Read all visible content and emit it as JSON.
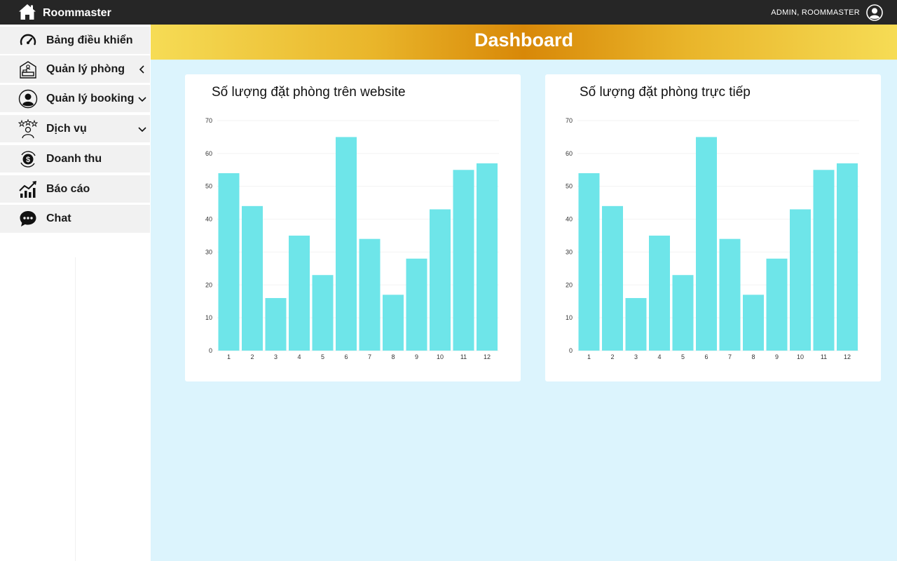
{
  "app": {
    "name": "Roommaster"
  },
  "user": {
    "label": "ADMIN, ROOMMASTER"
  },
  "sidebar": {
    "items": [
      {
        "label": "Bảng điều khiển",
        "icon": "speedometer-icon",
        "arrow": ""
      },
      {
        "label": "Quản lý phòng",
        "icon": "room-icon",
        "arrow": "chevron-left"
      },
      {
        "label": "Quản lý booking",
        "icon": "user-circle-icon",
        "arrow": "chevron-down"
      },
      {
        "label": "Dịch vụ",
        "icon": "service-rating-icon",
        "arrow": "chevron-down"
      },
      {
        "label": "Doanh thu",
        "icon": "money-icon",
        "arrow": ""
      },
      {
        "label": "Báo cáo",
        "icon": "growth-chart-icon",
        "arrow": ""
      },
      {
        "label": "Chat",
        "icon": "chat-bubble-icon",
        "arrow": ""
      }
    ]
  },
  "page": {
    "title": "Dashboard"
  },
  "colors": {
    "bar": "#6ee5e9",
    "topbar": "#262626",
    "main_bg": "#dcf4fd"
  },
  "chart_data": [
    {
      "type": "bar",
      "title": "Số lượng đặt phòng trên website",
      "categories": [
        "1",
        "2",
        "3",
        "4",
        "5",
        "6",
        "7",
        "8",
        "9",
        "10",
        "11",
        "12"
      ],
      "values": [
        54,
        44,
        16,
        35,
        23,
        65,
        34,
        17,
        28,
        43,
        55,
        57
      ],
      "ylim": [
        0,
        70
      ],
      "yticks": [
        0,
        10,
        20,
        30,
        40,
        50,
        60,
        70
      ],
      "xlabel": "",
      "ylabel": "",
      "grid": true
    },
    {
      "type": "bar",
      "title": "Số lượng đặt phòng trực tiếp",
      "categories": [
        "1",
        "2",
        "3",
        "4",
        "5",
        "6",
        "7",
        "8",
        "9",
        "10",
        "11",
        "12"
      ],
      "values": [
        54,
        44,
        16,
        35,
        23,
        65,
        34,
        17,
        28,
        43,
        55,
        57
      ],
      "ylim": [
        0,
        70
      ],
      "yticks": [
        0,
        10,
        20,
        30,
        40,
        50,
        60,
        70
      ],
      "xlabel": "",
      "ylabel": "",
      "grid": true
    }
  ]
}
